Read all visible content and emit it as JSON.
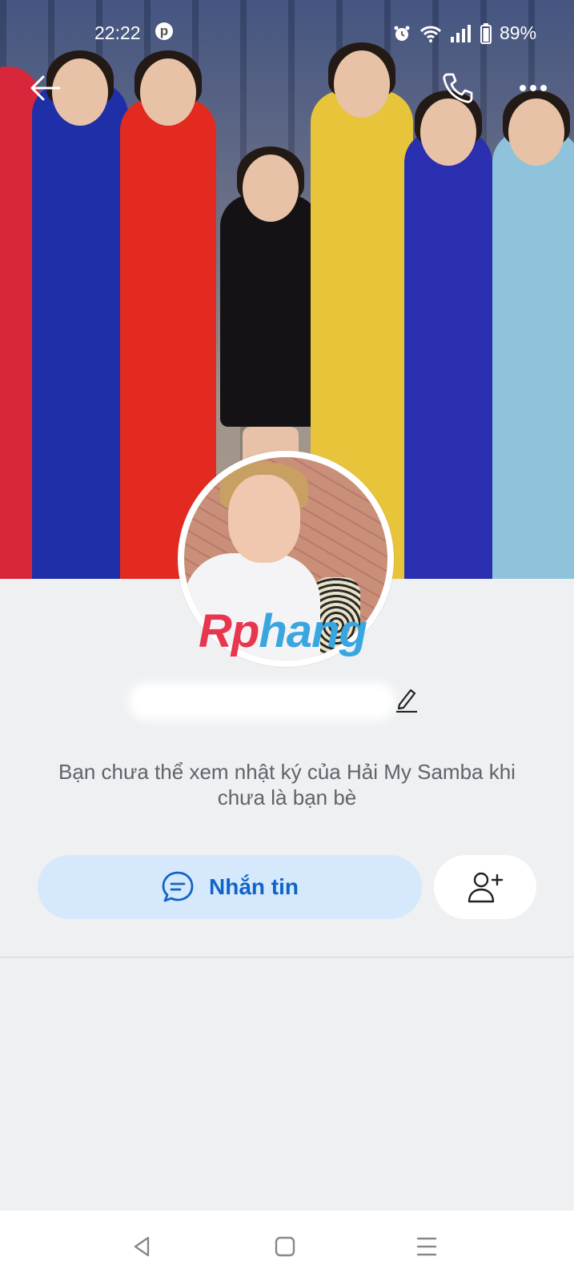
{
  "status_bar": {
    "time": "22:22",
    "notification_icon": "pinterest-icon",
    "battery_percent": "89%",
    "icons": [
      "alarm-icon",
      "wifi-icon",
      "signal-icon",
      "battery-icon"
    ]
  },
  "top_bar": {
    "back_icon": "arrow-left-icon",
    "call_icon": "phone-icon",
    "more_icon": "more-horizontal-icon"
  },
  "profile": {
    "watermark_part1": "Rp",
    "watermark_part2": "hang",
    "edit_icon": "pencil-icon"
  },
  "info": {
    "message": "Bạn chưa thể xem nhật ký của Hải My Samba khi chưa là bạn bè"
  },
  "actions": {
    "message_label": "Nhắn tin",
    "message_icon": "chat-bubble-icon",
    "add_friend_icon": "add-user-icon"
  },
  "nav_bar": {
    "items": [
      "back-triangle-icon",
      "home-square-icon",
      "menu-lines-icon"
    ]
  },
  "colors": {
    "accent": "#1064c8",
    "message_button_bg": "#d6e8fb",
    "page_bg": "#eef0f2"
  }
}
